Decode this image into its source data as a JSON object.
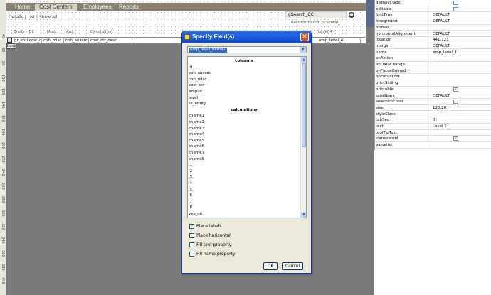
{
  "nav": {
    "tabs": [
      "Home",
      "Cost Centers",
      "Employees",
      "Reports"
    ],
    "active": "Cost Centers"
  },
  "form": {
    "details_text": "Details | List | Show All",
    "search_value": "gSearch_CC",
    "records_text": "Records found: %%total_",
    "groups": [
      "Entity - CC",
      "Misc",
      "Aux",
      "Description",
      "Level 4"
    ],
    "columns": [
      "gr_enti cost_ctr",
      "coh_misc",
      "coh_auxsrc",
      "cost_ctr_desc",
      "emp_level_4"
    ],
    "body_label": "Body"
  },
  "ruler_marks": [
    "40",
    "60",
    "80",
    "100",
    "120",
    "140",
    "160",
    "180",
    "200",
    "220",
    "240",
    "260",
    "280",
    "300",
    "320",
    "340",
    "360",
    "380",
    "400"
  ],
  "dialog": {
    "title": "Specify Field(s)",
    "close_symbol": "✕",
    "selected_field": "emp_level_name1",
    "list": [
      {
        "text": "columns",
        "header": true
      },
      {
        "text": "id"
      },
      {
        "text": "coh_auxsrc"
      },
      {
        "text": "coh_misc"
      },
      {
        "text": "cost_ctr"
      },
      {
        "text": "emplid"
      },
      {
        "text": "level_"
      },
      {
        "text": "ss_entity"
      },
      {
        "text": "calculations",
        "header": true
      },
      {
        "text": "cname1"
      },
      {
        "text": "cname2"
      },
      {
        "text": "cname3"
      },
      {
        "text": "cname4"
      },
      {
        "text": "cname5"
      },
      {
        "text": "cname6"
      },
      {
        "text": "cname7"
      },
      {
        "text": "cname8"
      },
      {
        "text": "l1"
      },
      {
        "text": "l2"
      },
      {
        "text": "l3"
      },
      {
        "text": "l4"
      },
      {
        "text": "l5"
      },
      {
        "text": "l6"
      },
      {
        "text": "l7"
      },
      {
        "text": "l8"
      },
      {
        "text": "yes_no"
      }
    ],
    "options": [
      {
        "label": "Place labels",
        "checked": true
      },
      {
        "label": "Place horizontal",
        "checked": false
      },
      {
        "label": "Fill text property",
        "checked": false
      },
      {
        "label": "Fill name property",
        "checked": false
      }
    ],
    "ok_label": "OK",
    "cancel_label": "Cancel"
  },
  "properties": [
    {
      "name": "displaysTags",
      "value": "",
      "checkbox": true,
      "checked": false
    },
    {
      "name": "editable",
      "value": "",
      "checkbox": true,
      "checked": false
    },
    {
      "name": "fontType",
      "value": "DEFAULT"
    },
    {
      "name": "foreground",
      "value": "DEFAULT"
    },
    {
      "name": "format",
      "value": ""
    },
    {
      "name": "horizontalAlignment",
      "value": "DEFAULT"
    },
    {
      "name": "location",
      "value": "441,121"
    },
    {
      "name": "margin",
      "value": "DEFAULT"
    },
    {
      "name": "name",
      "value": "emp_level_1"
    },
    {
      "name": "onAction",
      "value": ""
    },
    {
      "name": "onDataChange",
      "value": ""
    },
    {
      "name": "onFocusGained",
      "value": ""
    },
    {
      "name": "onFocusLost",
      "value": ""
    },
    {
      "name": "printSliding",
      "value": ""
    },
    {
      "name": "printable",
      "value": "",
      "checkbox": true,
      "checked": true
    },
    {
      "name": "scrollbars",
      "value": "DEFAULT"
    },
    {
      "name": "selectOnEnter",
      "value": "",
      "checkbox": true,
      "checked": false
    },
    {
      "name": "size",
      "value": "120,20"
    },
    {
      "name": "styleClass",
      "value": ""
    },
    {
      "name": "tabSeq",
      "value": "0"
    },
    {
      "name": "text",
      "value": "Level 1"
    },
    {
      "name": "toolTipText",
      "value": ""
    },
    {
      "name": "transparent",
      "value": "",
      "checkbox": true,
      "checked": true
    },
    {
      "name": "valuelist",
      "value": ""
    }
  ],
  "colors": {
    "titlebar": "#0b4ad0",
    "dialog_bg": "#ece9d8",
    "nav_bg": "#8a8070",
    "selection": "#316ac5"
  }
}
